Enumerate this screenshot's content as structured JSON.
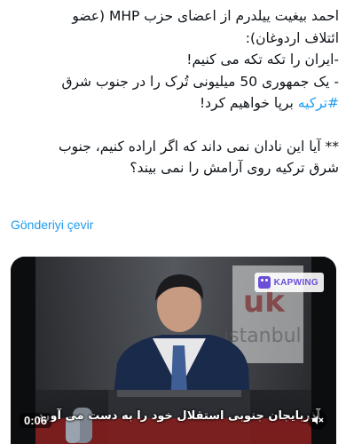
{
  "tweet": {
    "lines": [
      "احمد بیغیت ییلدرم از اعضای حزب MHP (عضو",
      "ائتلاف اردوغان):",
      "-ایران را تکه تکه می کنیم!",
      "- یک جمهوری 50 میلیونی تُرک را در جنوب شرق",
      "برپا خواهیم کرد!"
    ],
    "hashtag": "#ترکیه",
    "question_lines": [
      "** آیا این نادان نمی داند که اگر اراده کنیم، جنوب",
      "شرق ترکیه روی آرامش را نمی بیند؟"
    ]
  },
  "translate_label": "Gönderiyi çevir",
  "video": {
    "watermark": "KAPWING",
    "subtitle": "آذربایجان جنوبی استقلال خود را به دست می آورد",
    "time": "0:06",
    "mute_icon": "speaker-muted-icon"
  },
  "colors": {
    "link": "#1d9bf0",
    "text": "#0f1419"
  }
}
